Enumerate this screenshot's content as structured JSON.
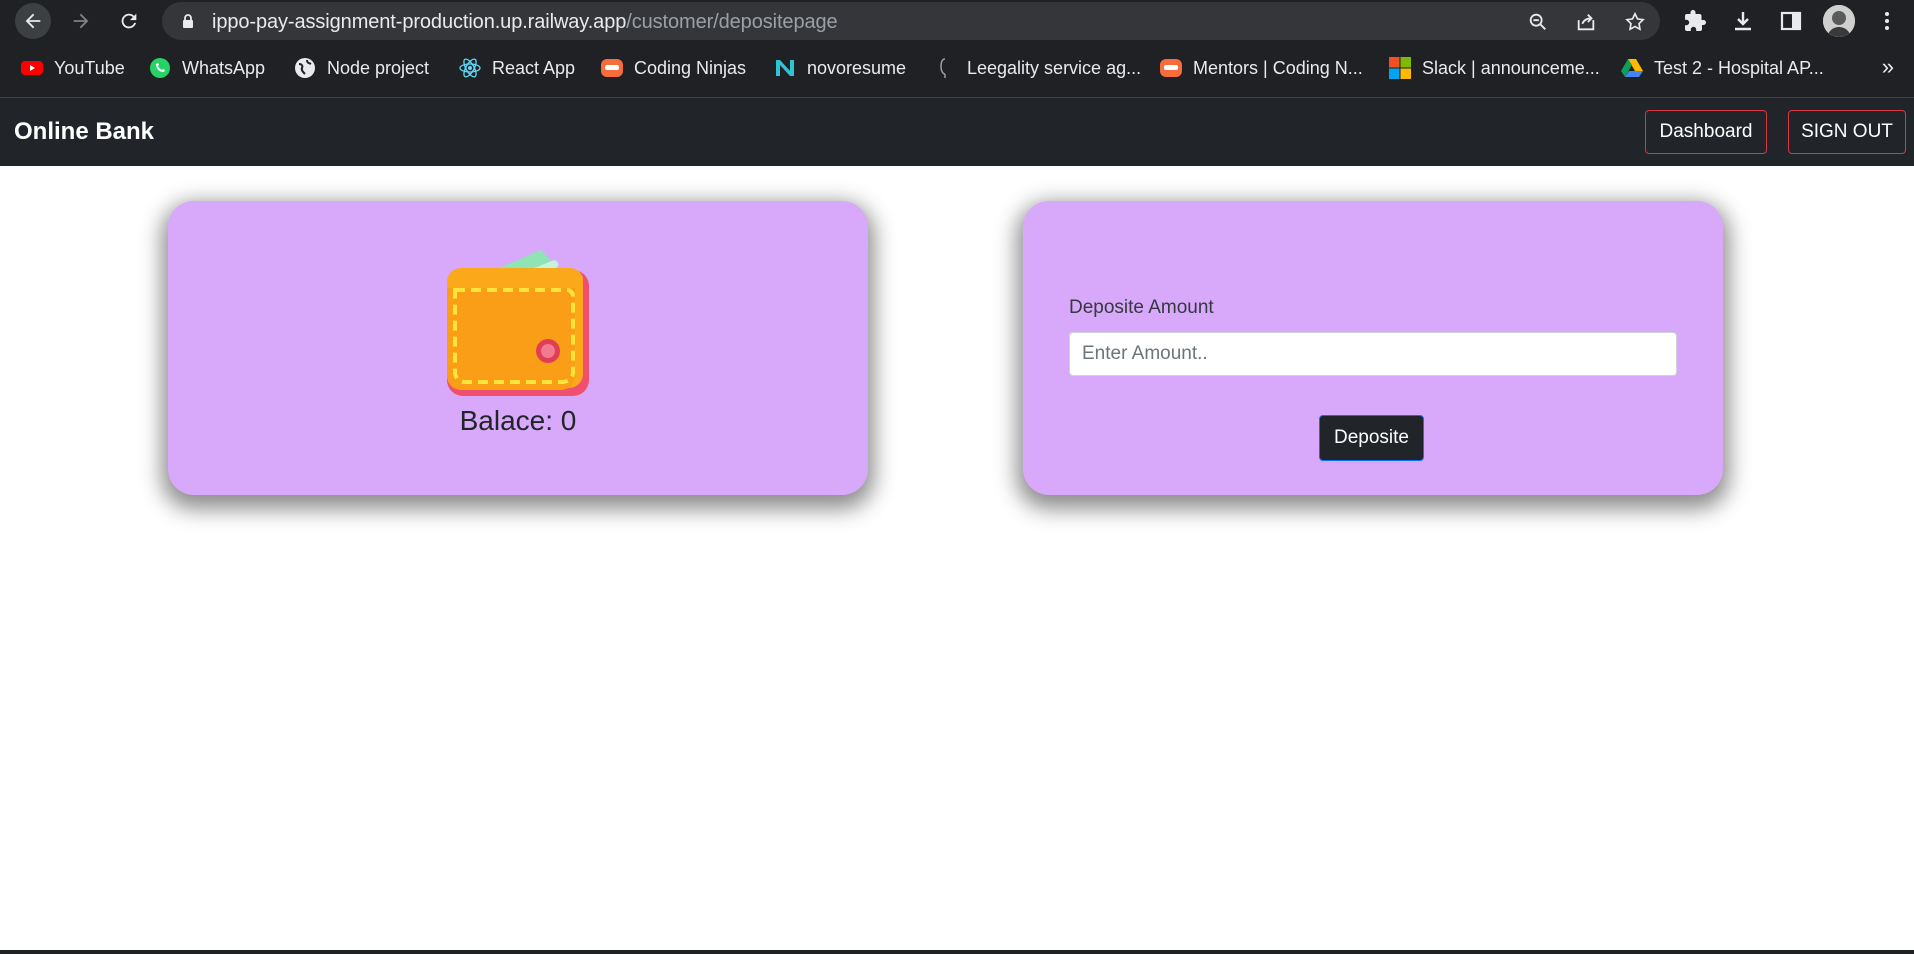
{
  "browser": {
    "url_host": "ippo-pay-assignment-production.up.railway.app",
    "url_path": "/customer/depositepage",
    "bookmarks": [
      {
        "label": "YouTube",
        "icon": "youtube-icon"
      },
      {
        "label": "WhatsApp",
        "icon": "whatsapp-icon"
      },
      {
        "label": "Node project",
        "icon": "globe-icon"
      },
      {
        "label": "React App",
        "icon": "react-icon"
      },
      {
        "label": "Coding Ninjas",
        "icon": "coding-ninjas-icon"
      },
      {
        "label": "novoresume",
        "icon": "novoresume-icon"
      },
      {
        "label": "Leegality service ag...",
        "icon": "leegality-icon"
      },
      {
        "label": "Mentors | Coding N...",
        "icon": "coding-ninjas-icon"
      },
      {
        "label": "Slack | announceme...",
        "icon": "microsoft-icon"
      },
      {
        "label": "Test 2 - Hospital AP...",
        "icon": "google-drive-icon"
      }
    ],
    "more_label": "»"
  },
  "navbar": {
    "brand": "Online Bank",
    "dashboard_label": "Dashboard",
    "signout_label": "SIGN OUT"
  },
  "balance_card": {
    "icon": "wallet-icon",
    "balance_text": "Balace: 0"
  },
  "deposit_card": {
    "label": "Deposite Amount",
    "placeholder": "Enter Amount..",
    "button_label": "Deposite"
  },
  "colors": {
    "card_bg": "#d8a8fa",
    "navbar_bg": "#212529",
    "nav_button_border": "#dc3545",
    "deposit_button_border": "#0d6efd"
  }
}
